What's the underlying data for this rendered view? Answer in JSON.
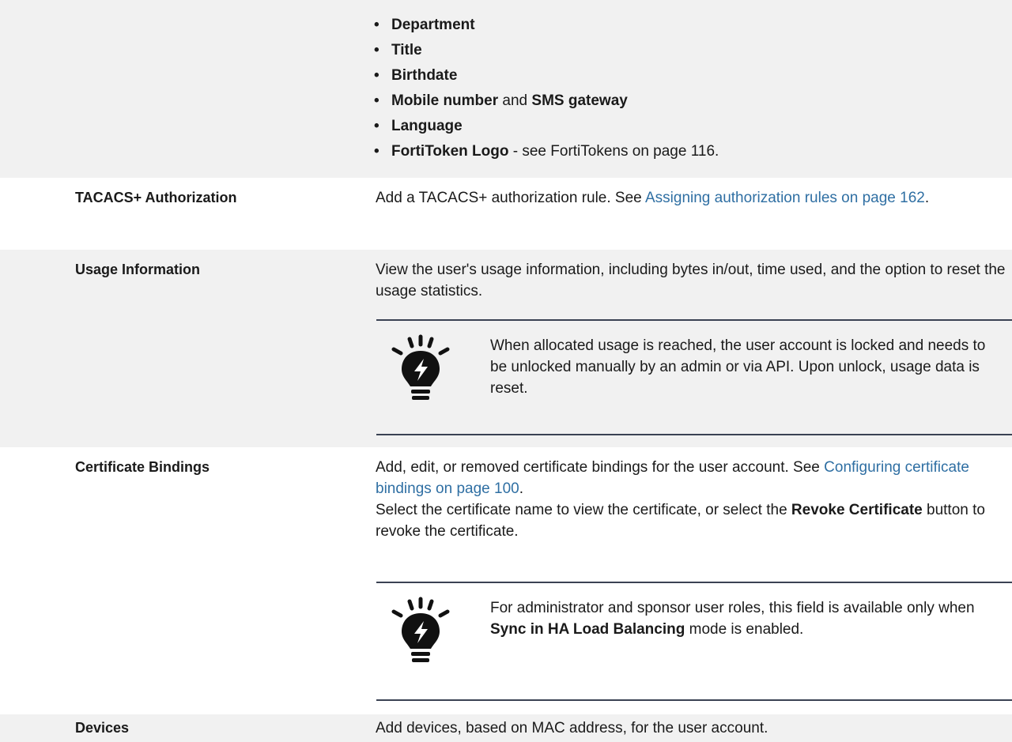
{
  "continuation": {
    "bullets": [
      {
        "bold": "Department"
      },
      {
        "bold": "Title"
      },
      {
        "bold": "Birthdate"
      },
      {
        "bold": "Mobile number",
        "mid": " and ",
        "bold2": "SMS gateway"
      },
      {
        "bold": "Language"
      },
      {
        "bold": "FortiToken Logo",
        "mid": " - see ",
        "link": "FortiTokens on page 116",
        "tail": "."
      }
    ]
  },
  "rows": {
    "tacacs": {
      "key": "TACACS+ Authorization",
      "text": "Add a TACACS+ authorization rule. See ",
      "link": "Assigning authorization rules on page 162",
      "tail": "."
    },
    "usage": {
      "key": "Usage Information",
      "text": "View the user's usage information, including bytes in/out, time used, and the option to reset the usage statistics.",
      "note": "When allocated usage is reached, the user account is locked and needs to be unlocked manually by an admin or via API. Upon unlock, usage data is reset."
    },
    "cert": {
      "key": "Certificate Bindings",
      "text1": "Add, edit, or removed certificate bindings for the user account. See ",
      "link": "Configuring certificate bindings on page 100",
      "tail": ".",
      "text2a": "Select the certificate name to view the certificate, or select the ",
      "bold": "Revoke Certificate",
      "text2b": " button to revoke the certificate.",
      "note_a": "For administrator and sponsor user roles, this field is available only when ",
      "note_bold": "Sync in HA Load Balancing",
      "note_b": " mode is enabled."
    },
    "devices": {
      "key": "Devices",
      "text": "Add devices, based on MAC address, for the user account."
    }
  },
  "icons": {
    "note": "lightbulb-tip-icon"
  },
  "colors": {
    "link": "#2f6fa3",
    "rule": "#3a4253",
    "shade": "#f1f1f1"
  }
}
